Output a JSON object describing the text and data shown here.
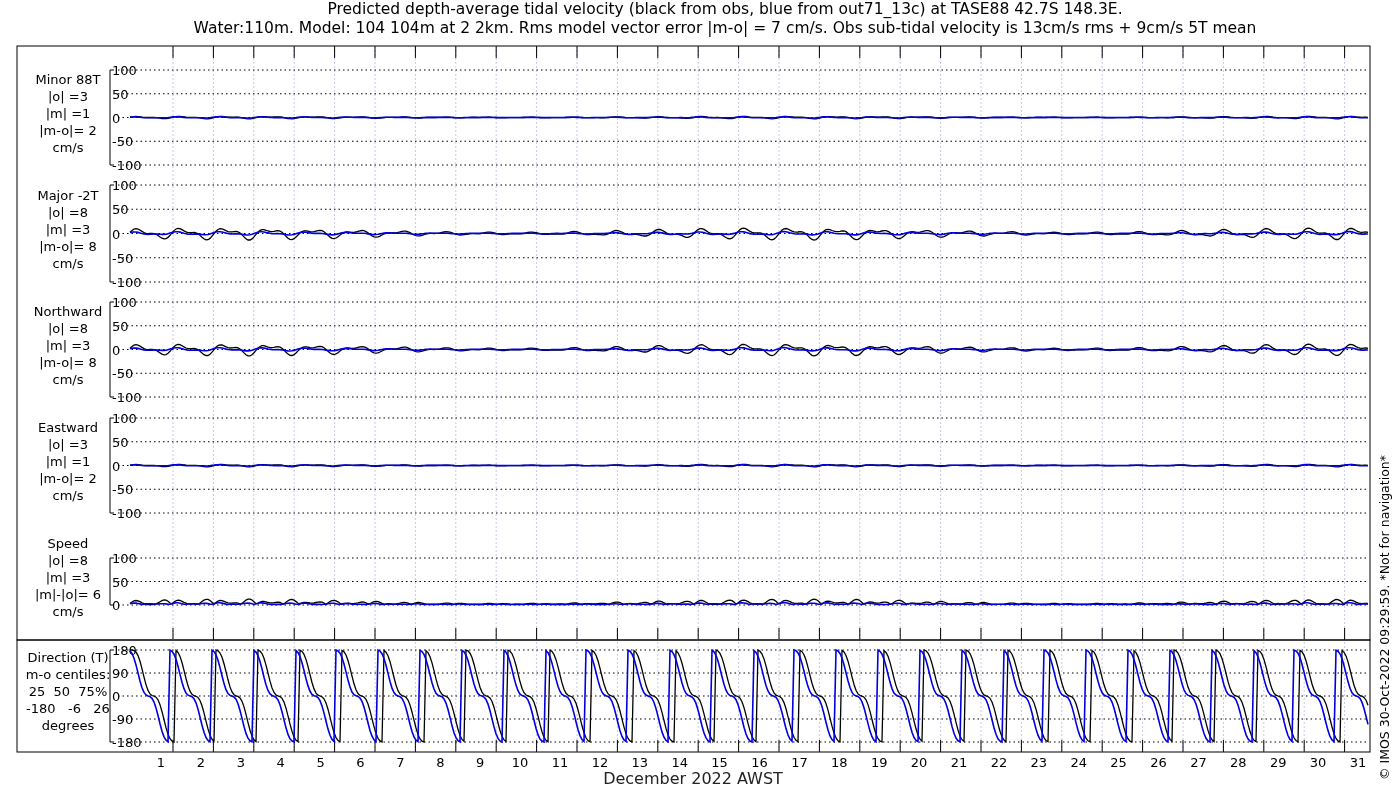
{
  "title": [
    "Predicted depth-average tidal velocity (black from obs, blue from out71_13c) at TASE88 42.7S 148.3E.",
    "Water:110m. Model: 104 104m at 2 2km. Rms model vector error |m-o| = 7 cm/s. Obs sub-tidal velocity is 13cm/s rms + 9cm/s 5T mean"
  ],
  "panels": [
    {
      "kind": "velocity",
      "label": [
        "Minor 88T",
        "|o| =3",
        "|m| =1",
        "|m-o|= 2",
        "cm/s"
      ],
      "yticks": [
        "100",
        "50",
        "0",
        "-50",
        "-100"
      ]
    },
    {
      "kind": "velocity",
      "label": [
        "Major -2T",
        "|o| =8",
        "|m| =3",
        "|m-o|= 8",
        "cm/s"
      ],
      "yticks": [
        "100",
        "50",
        "0",
        "-50",
        "-100"
      ]
    },
    {
      "kind": "velocity",
      "label": [
        "Northward",
        "|o| =8",
        "|m| =3",
        "|m-o|= 8",
        "cm/s"
      ],
      "yticks": [
        "100",
        "50",
        "0",
        "-50",
        "-100"
      ]
    },
    {
      "kind": "velocity",
      "label": [
        "Eastward",
        "|o| =3",
        "|m| =1",
        "|m-o|= 2",
        "cm/s"
      ],
      "yticks": [
        "100",
        "50",
        "0",
        "-50",
        "-100"
      ]
    },
    {
      "kind": "speed",
      "label": [
        "Speed",
        "|o| =8",
        "|m| =3",
        "|m|-|o|= 6",
        "cm/s"
      ],
      "yticks": [
        "100",
        "50",
        "0"
      ]
    },
    {
      "kind": "direction",
      "label": [
        "Direction (T)",
        "m-o centiles:",
        "25  50  75%",
        "-180   -6   26",
        "degrees"
      ],
      "yticks": [
        "180",
        "90",
        "0",
        "-90",
        "-180"
      ]
    }
  ],
  "xaxis": {
    "ticks": [
      "1",
      "2",
      "3",
      "4",
      "5",
      "6",
      "7",
      "8",
      "9",
      "10",
      "11",
      "12",
      "13",
      "14",
      "15",
      "16",
      "17",
      "18",
      "19",
      "20",
      "21",
      "22",
      "23",
      "24",
      "25",
      "26",
      "27",
      "28",
      "29",
      "30",
      "31"
    ],
    "label": "December 2022 AWST"
  },
  "credit": "© IMOS 30-Oct-2022 09:29:59.  *Not for navigation*"
}
